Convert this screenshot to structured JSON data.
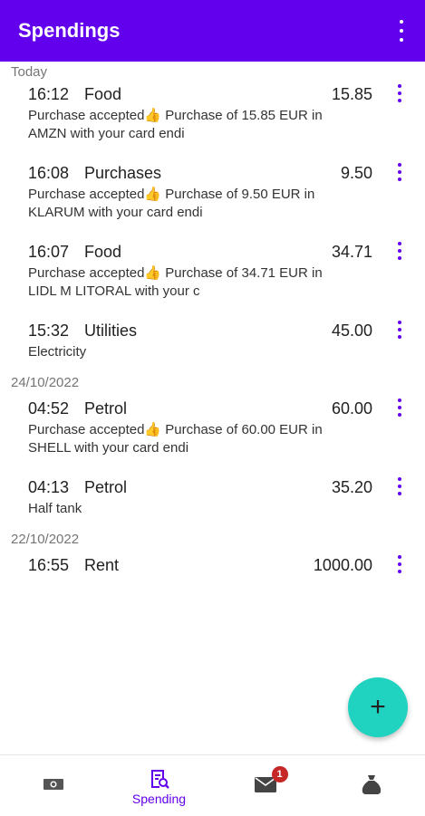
{
  "appbar": {
    "title": "Spendings",
    "menu_icon": "more-vert-icon"
  },
  "groups": [
    {
      "date": "Today",
      "entries": [
        {
          "time": "16:12",
          "category": "Food",
          "amount": "15.85",
          "note_lines": [
            "Purchase accepted👍 Purchase of 15.85 EUR in",
            "AMZN  with your card endi"
          ]
        },
        {
          "time": "16:08",
          "category": "Purchases",
          "amount": "9.50",
          "note_lines": [
            "Purchase accepted👍 Purchase of 9.50 EUR in",
            "KLARUM  with your card endi"
          ]
        },
        {
          "time": "16:07",
          "category": "Food",
          "amount": "34.71",
          "note_lines": [
            "Purchase accepted👍 Purchase of 34.71 EUR in",
            "LIDL M LITORAL with your c"
          ]
        },
        {
          "time": "15:32",
          "category": "Utilities",
          "amount": "45.00",
          "note_lines": [
            "Electricity"
          ]
        }
      ]
    },
    {
      "date": "24/10/2022",
      "entries": [
        {
          "time": "04:52",
          "category": "Petrol",
          "amount": "60.00",
          "note_lines": [
            "Purchase accepted👍 Purchase of 60.00 EUR in",
            "SHELL with your card endi"
          ]
        },
        {
          "time": "04:13",
          "category": "Petrol",
          "amount": "35.20",
          "note_lines": [
            "Half tank"
          ]
        }
      ]
    },
    {
      "date": "22/10/2022",
      "entries": [
        {
          "time": "16:55",
          "category": "Rent",
          "amount": "1000.00",
          "note_lines": []
        }
      ]
    }
  ],
  "fab": {
    "label": "+",
    "icon": "add-icon"
  },
  "bottom_nav": {
    "items": [
      {
        "name": "money",
        "icon": "banknote-icon",
        "label": ""
      },
      {
        "name": "spending",
        "icon": "receipt-search-icon",
        "label": "Spending"
      },
      {
        "name": "messages",
        "icon": "mail-icon",
        "label": "",
        "badge": "1"
      },
      {
        "name": "savings",
        "icon": "money-bag-icon",
        "label": ""
      }
    ]
  },
  "colors": {
    "primary": "#6200ee",
    "fab": "#1fd3c0",
    "badge": "#c62828"
  }
}
